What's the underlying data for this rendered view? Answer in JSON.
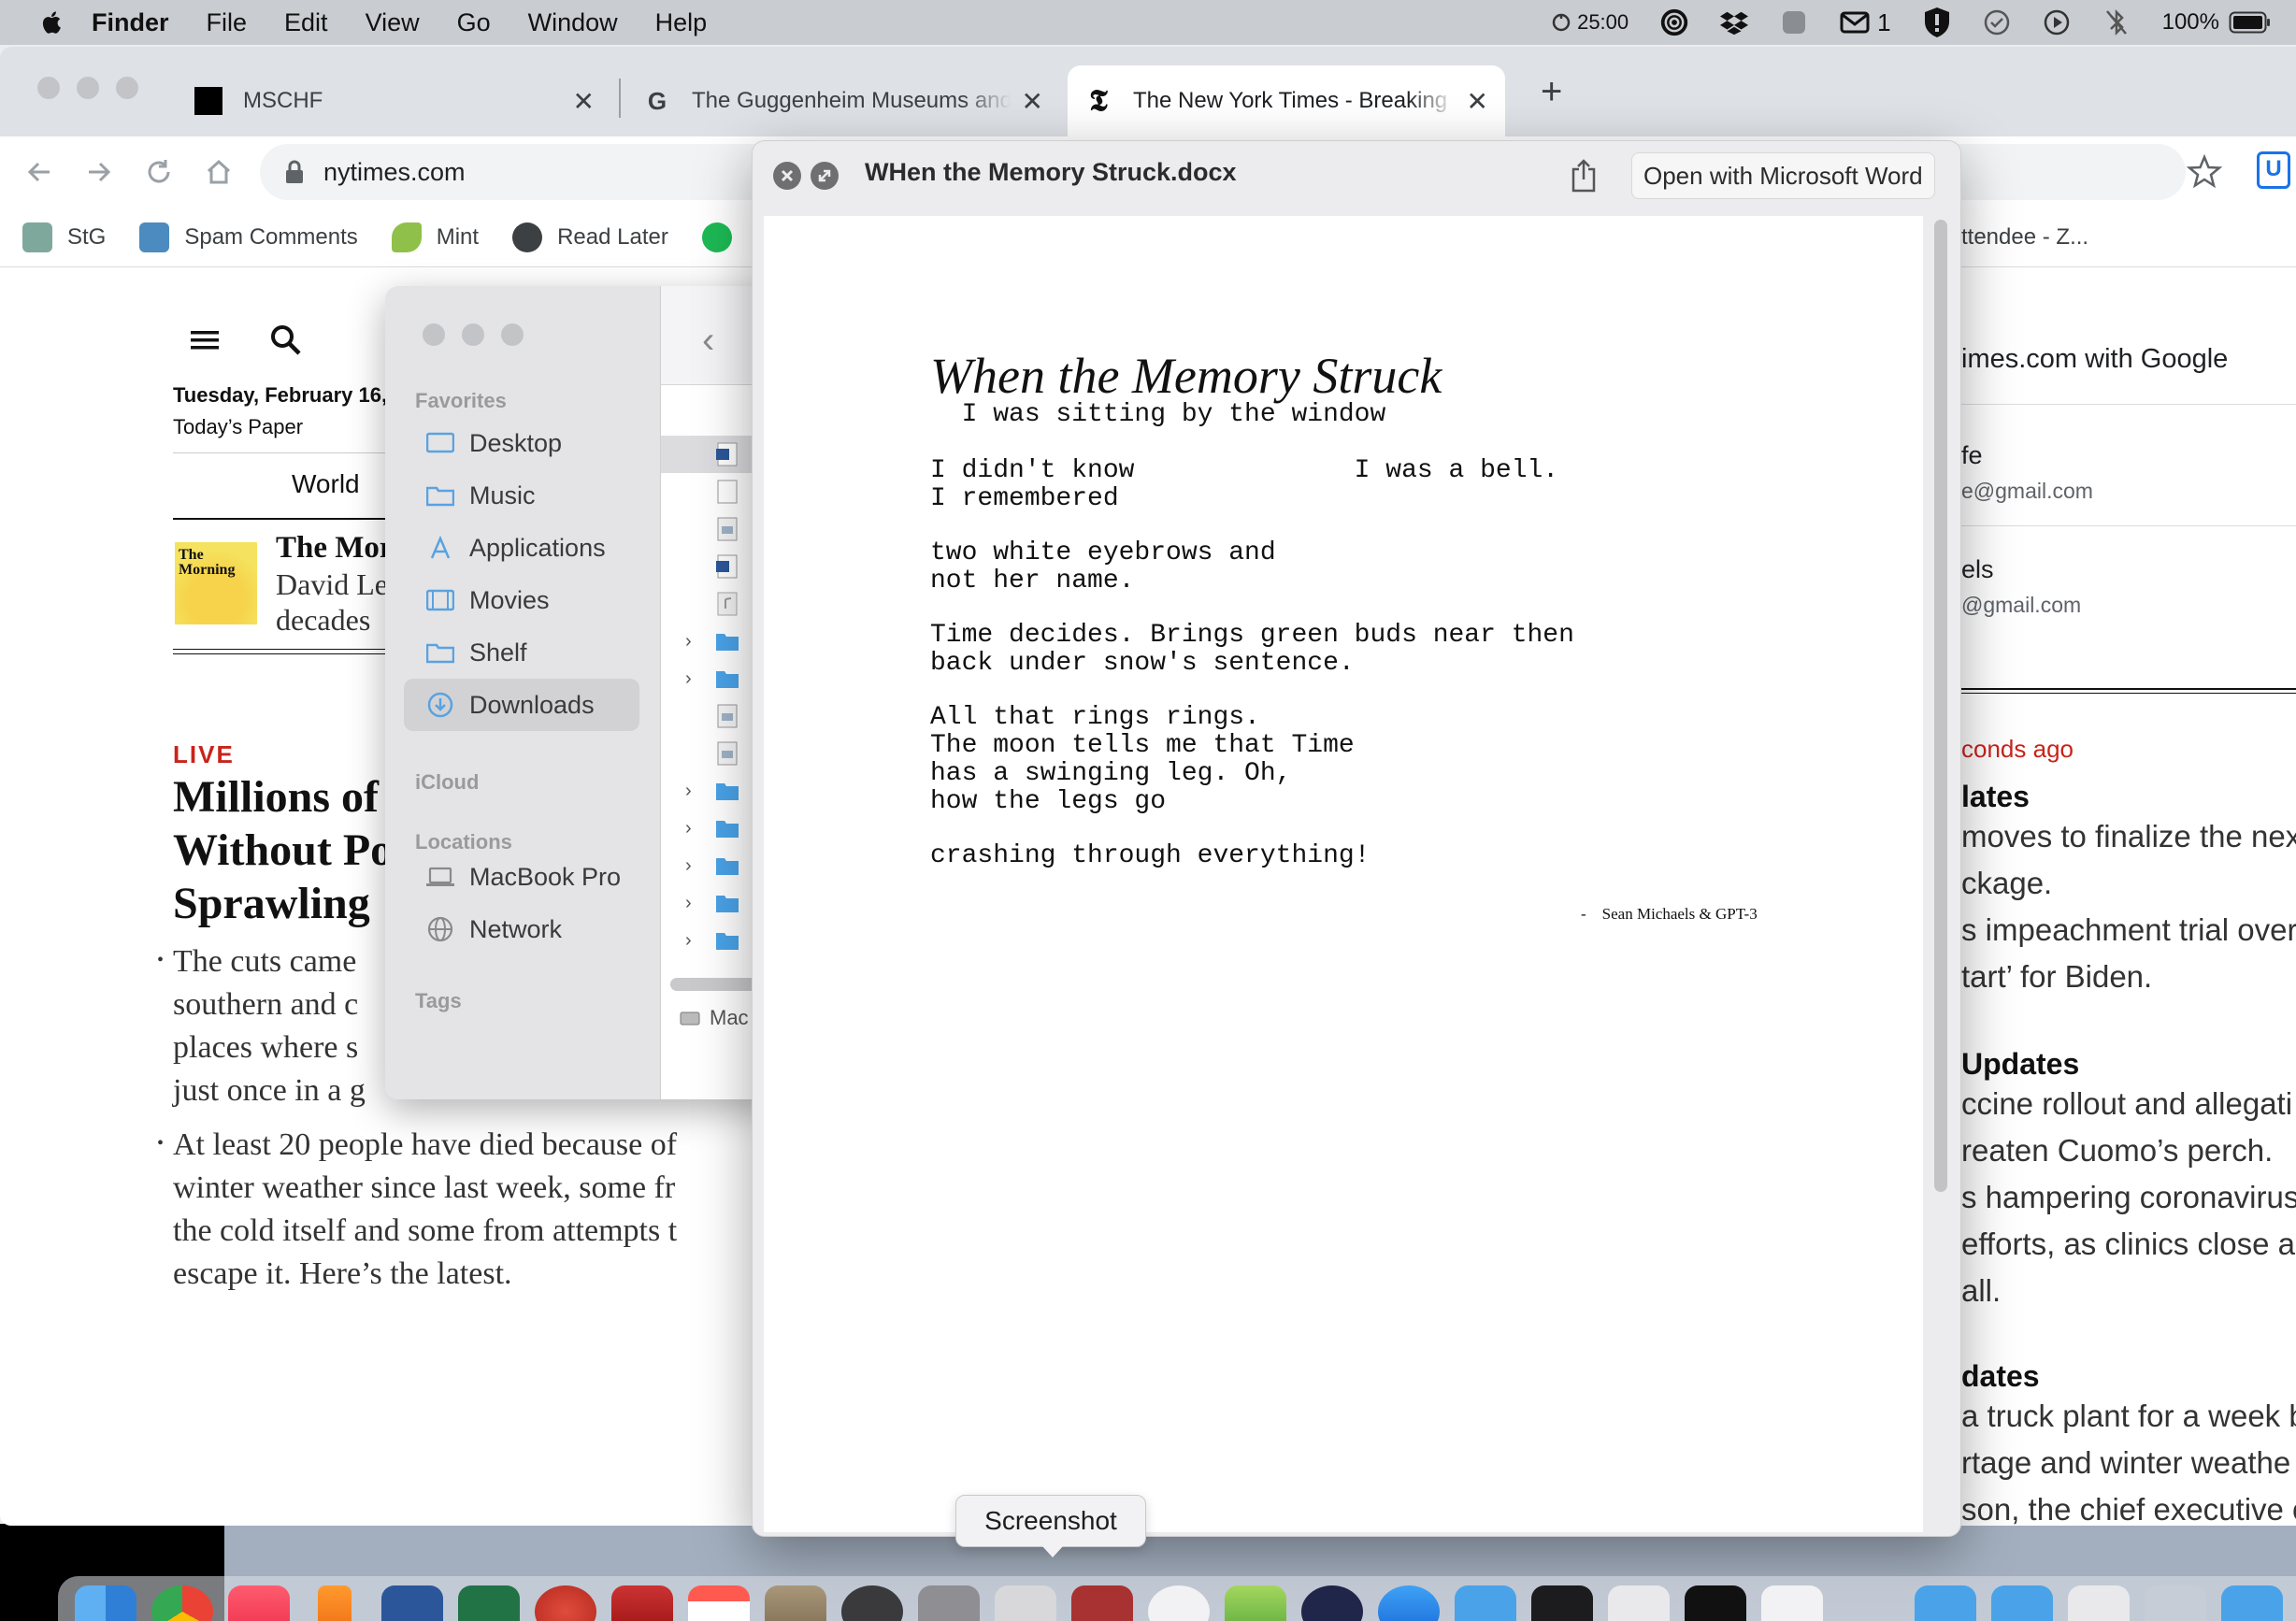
{
  "menubar": {
    "app": "Finder",
    "items": [
      "File",
      "Edit",
      "View",
      "Go",
      "Window",
      "Help"
    ],
    "status": {
      "timer": "25:00",
      "mail_count": "1",
      "battery": "100%"
    }
  },
  "browser": {
    "tabs": [
      {
        "title": "MSCHF",
        "favicon": "mschf-square-icon"
      },
      {
        "title": "The Guggenheim Museums and Foundation",
        "favicon": "google-g-icon"
      },
      {
        "title": "The New York Times - Breaking News",
        "favicon": "nyt-t-icon"
      }
    ],
    "url": "nytimes.com",
    "bookmarks": [
      "StG",
      "Spam Comments",
      "Mint",
      "Read Later"
    ],
    "bookmark_right": "ttendee - Z..."
  },
  "nyt": {
    "date": "Tuesday, February 16,",
    "todays_paper": "Today’s Paper",
    "section": "World",
    "morning": {
      "thumb": "The Morning",
      "title": "The Mor",
      "sub1": "David Le",
      "sub2": "decades"
    },
    "live": "LIVE",
    "headline": [
      "Millions of",
      "Without Po",
      "Sprawling "
    ],
    "bullets": [
      [
        "The cuts came",
        "southern and c",
        "places where s",
        "just once in a g"
      ],
      [
        "At least 20 people have died because of",
        "winter weather since last week, some fr",
        "the cold itself and some from attempts t",
        "escape it. Here’s the latest."
      ]
    ],
    "signin": "imes.com with Google",
    "accounts": [
      {
        "name": "fe",
        "email": "e@gmail.com"
      },
      {
        "name": "els",
        "email": "@gmail.com"
      }
    ],
    "right_time": "conds ago",
    "right_sections": [
      {
        "head": "lates",
        "lines": [
          "moves to finalize the next",
          "ckage.",
          "s impeachment trial over",
          "tart’ for Biden."
        ]
      },
      {
        "head": " Updates",
        "lines": [
          "ccine rollout and allegati",
          "reaten Cuomo’s perch.",
          "s hampering coronavirus",
          "efforts, as clinics close a",
          "all."
        ]
      },
      {
        "head": "dates",
        "lines": [
          "a truck plant for a week b",
          "rtage and winter weathe",
          "son, the chief executive o"
        ]
      }
    ]
  },
  "finder": {
    "favorites_label": "Favorites",
    "favorites": [
      "Desktop",
      "Music",
      "Applications",
      "Movies",
      "Shelf",
      "Downloads"
    ],
    "icloud_label": "iCloud",
    "locations_label": "Locations",
    "locations": [
      "MacBook Pro",
      "Network"
    ],
    "tags_label": "Tags",
    "path": "Mac"
  },
  "quicklook": {
    "filename": "WHen the Memory Struck.docx",
    "open_button": "Open with Microsoft Word",
    "doc": {
      "title": "When the Memory Struck",
      "subtitle": "  I was sitting by the window",
      "stanza1": "I didn't know              I was a bell.\nI remembered",
      "stanza2": "two white eyebrows and\nnot her name.",
      "stanza3": "Time decides. Brings green buds near then\nback under snow's sentence.",
      "stanza4": "All that rings rings.\nThe moon tells me that Time\nhas a swinging leg. Oh,\nhow the legs go",
      "stanza5": "crashing through everything!",
      "signature": "-    Sean Michaels & GPT-3"
    }
  },
  "tooltip": "Screenshot",
  "colors": {
    "nyt_live_red": "#c9231b",
    "chrome_tabbar": "#dee1e6",
    "finder_sidebar": "#e4e4e6",
    "folder_blue": "#4aa3e8"
  }
}
